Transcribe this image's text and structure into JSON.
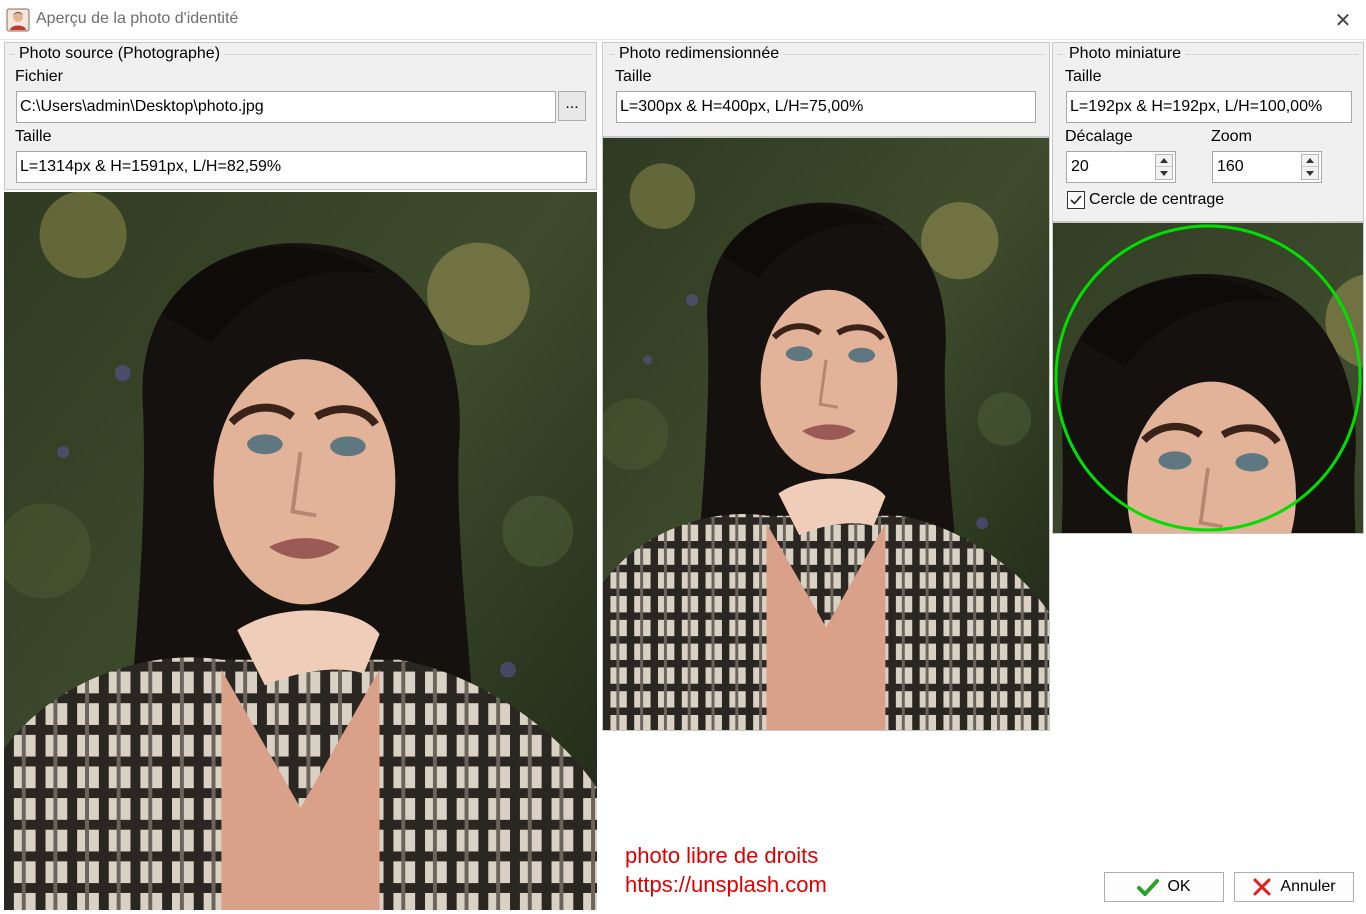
{
  "window": {
    "title": "Aperçu de la photo d'identité",
    "close_symbol": "✕",
    "icon": "user-portrait-icon"
  },
  "source_panel": {
    "legend": "Photo source (Photographe)",
    "file_label": "Fichier",
    "file_value": "C:\\Users\\admin\\Desktop\\photo.jpg",
    "browse_label": "...",
    "size_label": "Taille",
    "size_value": "L=1314px & H=1591px, L/H=82,59%"
  },
  "resized_panel": {
    "legend": "Photo redimensionnée",
    "size_label": "Taille",
    "size_value": "L=300px & H=400px, L/H=75,00%"
  },
  "thumbnail_panel": {
    "legend": "Photo miniature",
    "size_label": "Taille",
    "size_value": "L=192px & H=192px, L/H=100,00%",
    "offset_label": "Décalage",
    "offset_value": "20",
    "zoom_label": "Zoom",
    "zoom_value": "160",
    "center_circle_label": "Cercle de centrage",
    "center_circle_checked": true,
    "circle_color": "#00e000"
  },
  "watermark": {
    "line1": "photo libre de droits",
    "line2": "https://unsplash.com",
    "color": "#e00000"
  },
  "buttons": {
    "ok_label": "OK",
    "ok_icon": "checkmark-icon",
    "cancel_label": "Annuler",
    "cancel_icon": "cross-icon"
  }
}
